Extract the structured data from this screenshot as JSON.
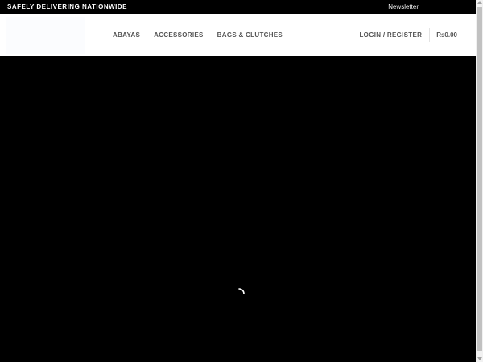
{
  "topbar": {
    "announcement": "SAFELY DELIVERING NATIONWIDE",
    "newsletter": "Newsletter"
  },
  "header": {
    "nav": [
      {
        "label": "ABAYAS"
      },
      {
        "label": "ACCESSORIES"
      },
      {
        "label": "BAGS & CLUTCHES"
      }
    ],
    "login": "LOGIN / REGISTER",
    "cart_total": "Rs0.00"
  },
  "icons": {
    "loading": "spinner-icon"
  },
  "colors": {
    "topbar_bg": "#000000",
    "hero_bg": "#000000",
    "nav_text": "#555555"
  }
}
